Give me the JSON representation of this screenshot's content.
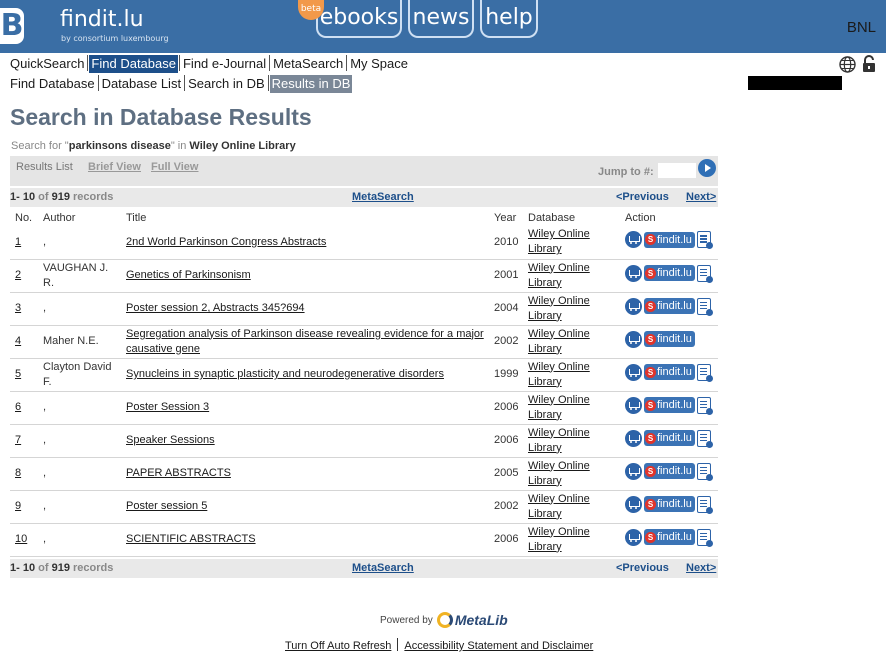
{
  "header": {
    "logo_text": "findit.lu",
    "logo_sub": "by consortium luxembourg",
    "logo_mark": "B",
    "beta_badge": "beta",
    "tabs": [
      "ebooks",
      "news",
      "help"
    ],
    "institution": "BNL"
  },
  "nav": {
    "main": [
      "QuickSearch",
      "Find Database",
      "Find e-Journal",
      "MetaSearch",
      "My Space"
    ],
    "sub": [
      "Find Database",
      "Database List",
      "Search in DB",
      "Results in DB"
    ]
  },
  "page": {
    "title": "Search in Database Results",
    "search_prefix": "Search for \"",
    "search_term": "parkinsons disease",
    "search_mid": "\" in ",
    "search_db": "Wiley Online Library"
  },
  "results_bar": {
    "label": "Results List",
    "brief_view": "Brief View",
    "full_view": "Full View",
    "jump_label": "Jump to #:"
  },
  "counts": {
    "range": "1- 10",
    "of": "of",
    "total": "919",
    "records": "records",
    "metasearch": "MetaSearch",
    "previous": "<Previous",
    "next": "Next>"
  },
  "table": {
    "headers": [
      "No.",
      "Author",
      "Title",
      "Year",
      "Database",
      "Action"
    ],
    "findit_label": "findit.lu",
    "rows": [
      {
        "no": "1",
        "author": ",",
        "title": "2nd World Parkinson Congress Abstracts",
        "year": "2010",
        "database": "Wiley Online Library"
      },
      {
        "no": "2",
        "author": "VAUGHAN J. R.",
        "title": "Genetics of Parkinsonism",
        "year": "2001",
        "database": "Wiley Online Library"
      },
      {
        "no": "3",
        "author": ",",
        "title": "Poster session 2, Abstracts 345?694",
        "year": "2004",
        "database": "Wiley Online Library"
      },
      {
        "no": "4",
        "author": "Maher N.E.",
        "title": "Segregation analysis of Parkinson disease revealing evidence for a major causative gene",
        "year": "2002",
        "database": "Wiley Online Library"
      },
      {
        "no": "5",
        "author": "Clayton David F.",
        "title": "Synucleins in synaptic plasticity and neurodegenerative disorders",
        "year": "1999",
        "database": "Wiley Online Library"
      },
      {
        "no": "6",
        "author": ",",
        "title": "Poster Session 3",
        "year": "2006",
        "database": "Wiley Online Library"
      },
      {
        "no": "7",
        "author": ",",
        "title": "Speaker Sessions",
        "year": "2006",
        "database": "Wiley Online Library"
      },
      {
        "no": "8",
        "author": ",",
        "title": "PAPER ABSTRACTS",
        "year": "2005",
        "database": "Wiley Online Library"
      },
      {
        "no": "9",
        "author": ",",
        "title": "Poster session 5",
        "year": "2002",
        "database": "Wiley Online Library"
      },
      {
        "no": "10",
        "author": ",",
        "title": "SCIENTIFIC ABSTRACTS",
        "year": "2006",
        "database": "Wiley Online Library"
      }
    ]
  },
  "footer": {
    "powered_by": "Powered by",
    "metalib": "MetaLib",
    "links": [
      "Turn Off Auto Refresh",
      "Accessibility Statement and Disclaimer"
    ]
  }
}
